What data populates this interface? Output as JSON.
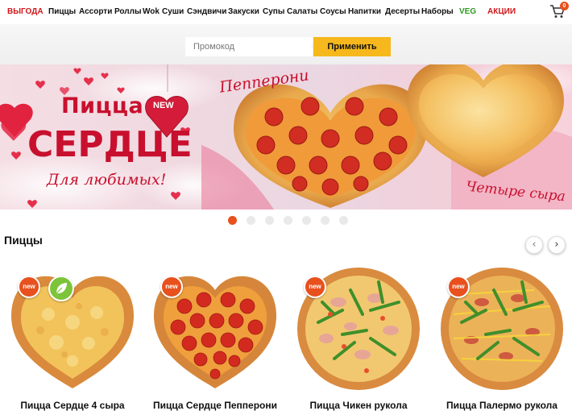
{
  "nav": {
    "items": [
      "ВЫГОДА",
      "Пиццы",
      "Ассорти",
      "Роллы",
      "Wok",
      "Суши",
      "Сэндвичи",
      "Закуски",
      "Супы",
      "Салаты",
      "Соусы",
      "Напитки",
      "Десерты",
      "Наборы",
      "VEG",
      "АКЦИИ"
    ],
    "cart_count": "0"
  },
  "promo": {
    "placeholder": "Промокод",
    "apply_label": "Применить"
  },
  "banner": {
    "title_line1": "Пицца",
    "title_line2": "СЕРДЦЕ",
    "tagline": "Для любимых!",
    "new_label": "NEW",
    "label_left_pizza": "Пепперони",
    "label_right_pizza": "Четыре сыра",
    "slides_count": 7,
    "active_slide": 1
  },
  "section": {
    "title": "Пиццы",
    "prev_icon": "‹",
    "next_icon": "›"
  },
  "products": [
    {
      "name": "Пицца Сердце 4 сыра",
      "badges": [
        "new",
        "veg"
      ]
    },
    {
      "name": "Пицца Сердце Пепперони",
      "badges": [
        "new"
      ]
    },
    {
      "name": "Пицца Чикен рукола",
      "badges": [
        "new"
      ]
    },
    {
      "name": "Пицца Палермо рукола",
      "badges": [
        "new"
      ]
    }
  ],
  "badge_new_label": "new",
  "colors": {
    "accent": "#e8501e",
    "brand_red": "#d0171b",
    "veg_green": "#2d9a1f",
    "apply_button": "#f6b81c"
  }
}
